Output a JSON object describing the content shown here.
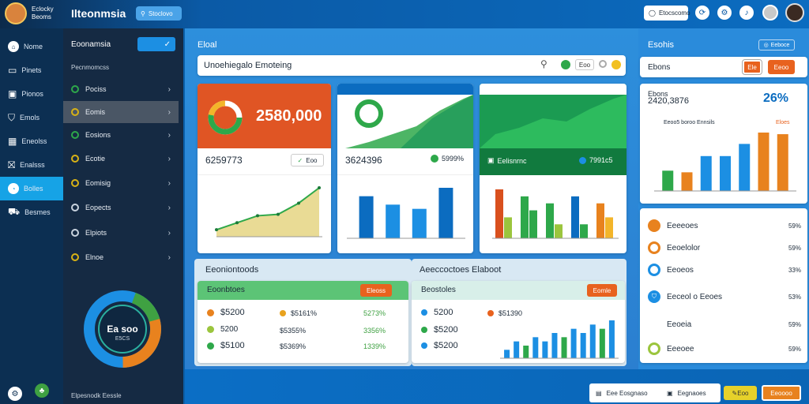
{
  "app": {
    "title": "Ilteonmsia",
    "logo_text": "Eclocky Beoms",
    "search_label": "Stoclovo"
  },
  "topbar": {
    "button_label": "Etocscomo"
  },
  "sidebar": {
    "items": [
      {
        "label": "Nome",
        "icon": "home-icon"
      },
      {
        "label": "Pinets",
        "icon": "inbox-icon"
      },
      {
        "label": "Pionos",
        "icon": "monitor-icon"
      },
      {
        "label": "Emols",
        "icon": "bag-icon"
      },
      {
        "label": "Eneolss",
        "icon": "store-icon"
      },
      {
        "label": "Enalsss",
        "icon": "gift-icon"
      },
      {
        "label": "Bolles",
        "icon": "chart-icon",
        "active": true
      },
      {
        "label": "Besmes",
        "icon": "car-icon"
      }
    ],
    "footer_items": [
      "gear-icon",
      "leaf-icon"
    ]
  },
  "subnav": {
    "title": "Eoonamsia",
    "section": "Pecnmomcss",
    "items": [
      {
        "label": "Pociss",
        "color": "#2ea84a"
      },
      {
        "label": "Eomis",
        "color": "#d8b216",
        "active": true
      },
      {
        "label": "Eosions",
        "color": "#2ea84a"
      },
      {
        "label": "Ecotie",
        "color": "#d8b216"
      },
      {
        "label": "Eomisig",
        "color": "#d8b216"
      },
      {
        "label": "Eopects",
        "color": "#c9d3de"
      },
      {
        "label": "Elpiots",
        "color": "#c9d3de"
      },
      {
        "label": "Elnoe",
        "color": "#d8b216"
      }
    ],
    "donut": {
      "value": "Ea soo",
      "sub": "E5CS"
    },
    "footer": "Elpesnodk Eessle"
  },
  "main": {
    "title": "Eloal",
    "search_value": "Unoehiegalo Emoteing",
    "card1": {
      "value": "2580,000",
      "footer_value": "6259773",
      "badge": "Eoo"
    },
    "card2": {
      "footer_value": "3624396",
      "badge": "5999%"
    },
    "card3": {
      "footer_label": "Eelisnrnc",
      "footer_badge": "7991c5"
    },
    "panel_left": {
      "title": "Eeoniontoods",
      "header": "Eoonbtoes",
      "button": "Eleoss",
      "rows": [
        {
          "value": "5200",
          "pct": "5161%",
          "delta": "5273%"
        },
        {
          "value": "5200",
          "pct": "5355%",
          "delta": "3356%"
        },
        {
          "value": "5100",
          "pct": "5369%",
          "delta": "1339%"
        }
      ]
    },
    "panel_right": {
      "title": "Aeeccoctoes Elaboot",
      "header": "Beostoles",
      "button": "Eomle",
      "rows": [
        {
          "value": "5200",
          "pct": "51390"
        },
        {
          "value": "5200"
        },
        {
          "value": "5200"
        }
      ]
    }
  },
  "right": {
    "title": "Esohis",
    "badge": "Eeboce",
    "row_label": "Ebons",
    "btn1": "Ele",
    "btn2": "Eeoo",
    "stat_value": "2420,3876",
    "stat_pct": "26%",
    "chart_label": "Eeoo5 boroo Ennsils",
    "chart_badge": "Eloes",
    "list": [
      {
        "label": "Eeeeoes",
        "pct": "59%"
      },
      {
        "label": "Eeoelolor",
        "pct": "59%"
      },
      {
        "label": "Eeoeos",
        "pct": "33%"
      },
      {
        "label": "Eeceol o Eeoes",
        "pct": "53%"
      },
      {
        "label": "Eeoeia",
        "pct": "59%"
      },
      {
        "label": "Eeeoee",
        "pct": "59%"
      }
    ]
  },
  "bottombar": {
    "item1": "Eee Eosgnaso",
    "item2": "Eegnaoes",
    "btn1": "Eoo",
    "btn2": "Eeoooo"
  },
  "chart_data": [
    {
      "type": "line",
      "values": [
        1,
        2,
        3,
        3.2,
        4.8,
        7
      ]
    },
    {
      "type": "bar",
      "values": [
        5,
        4,
        3.5,
        6
      ],
      "ylim": [
        0,
        6
      ]
    },
    {
      "type": "bar",
      "series": [
        {
          "name": "s1",
          "values": [
            7,
            6,
            5,
            6,
            5
          ]
        },
        {
          "name": "s2",
          "values": [
            3,
            4,
            2,
            2,
            3
          ]
        }
      ]
    },
    {
      "type": "bar",
      "values": [
        2.5,
        2.3,
        4.3,
        4.3,
        5.8,
        7.2,
        7
      ]
    },
    {
      "type": "bar",
      "values": [
        3,
        4,
        5,
        8,
        6,
        7,
        9,
        8,
        10
      ]
    },
    {
      "type": "bar",
      "values": [
        2,
        4,
        3,
        5,
        4,
        6,
        5,
        7,
        6,
        8,
        7,
        9
      ]
    }
  ]
}
